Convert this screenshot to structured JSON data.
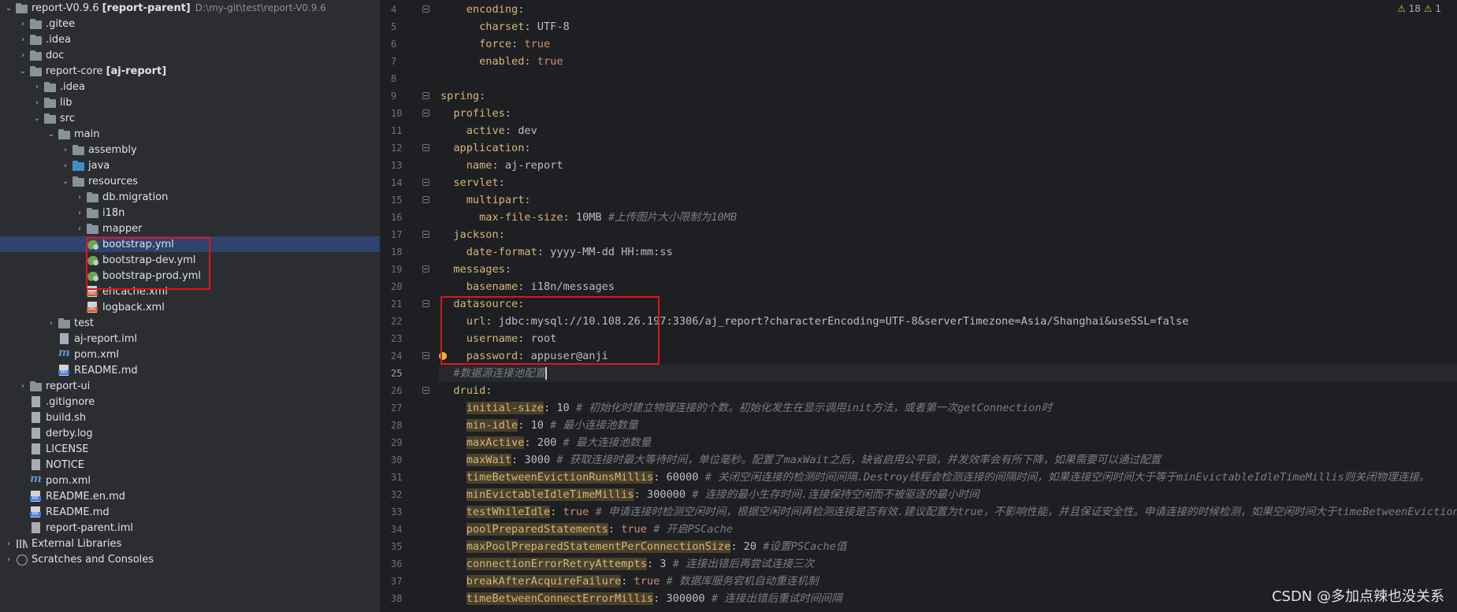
{
  "tree": [
    {
      "depth": 0,
      "arrow": "open",
      "icon": "folder",
      "label": "report-V0.9.6",
      "bold_part": "[report-parent]",
      "path": "D:\\my-git\\test\\report-V0.9.6"
    },
    {
      "depth": 1,
      "arrow": "closed",
      "icon": "folder",
      "label": ".gitee"
    },
    {
      "depth": 1,
      "arrow": "closed",
      "icon": "folder",
      "label": ".idea"
    },
    {
      "depth": 1,
      "arrow": "closed",
      "icon": "folder",
      "label": "doc"
    },
    {
      "depth": 1,
      "arrow": "open",
      "icon": "folder",
      "label": "report-core",
      "bold_part": "[aj-report]"
    },
    {
      "depth": 2,
      "arrow": "closed",
      "icon": "folder",
      "label": ".idea"
    },
    {
      "depth": 2,
      "arrow": "closed",
      "icon": "folder",
      "label": "lib"
    },
    {
      "depth": 2,
      "arrow": "open",
      "icon": "folder",
      "label": "src"
    },
    {
      "depth": 3,
      "arrow": "open",
      "icon": "folder",
      "label": "main"
    },
    {
      "depth": 4,
      "arrow": "closed",
      "icon": "folder",
      "label": "assembly"
    },
    {
      "depth": 4,
      "arrow": "closed",
      "icon": "folder-blue",
      "label": "java"
    },
    {
      "depth": 4,
      "arrow": "open",
      "icon": "folder-res",
      "label": "resources"
    },
    {
      "depth": 5,
      "arrow": "closed",
      "icon": "folder",
      "label": "db.migration"
    },
    {
      "depth": 5,
      "arrow": "closed",
      "icon": "folder",
      "label": "i18n"
    },
    {
      "depth": 5,
      "arrow": "closed",
      "icon": "folder",
      "label": "mapper"
    },
    {
      "depth": 5,
      "arrow": "none",
      "icon": "yml",
      "label": "bootstrap.yml",
      "selected": true
    },
    {
      "depth": 5,
      "arrow": "none",
      "icon": "yml",
      "label": "bootstrap-dev.yml"
    },
    {
      "depth": 5,
      "arrow": "none",
      "icon": "yml",
      "label": "bootstrap-prod.yml"
    },
    {
      "depth": 5,
      "arrow": "none",
      "icon": "xml",
      "label": "ehcache.xml"
    },
    {
      "depth": 5,
      "arrow": "none",
      "icon": "xml",
      "label": "logback.xml"
    },
    {
      "depth": 3,
      "arrow": "closed",
      "icon": "folder",
      "label": "test"
    },
    {
      "depth": 3,
      "arrow": "none",
      "icon": "iml",
      "label": "aj-report.iml"
    },
    {
      "depth": 3,
      "arrow": "none",
      "icon": "mfile",
      "label": "pom.xml"
    },
    {
      "depth": 3,
      "arrow": "none",
      "icon": "md",
      "label": "README.md"
    },
    {
      "depth": 1,
      "arrow": "closed",
      "icon": "folder",
      "label": "report-ui"
    },
    {
      "depth": 1,
      "arrow": "none",
      "icon": "file",
      "label": ".gitignore"
    },
    {
      "depth": 1,
      "arrow": "none",
      "icon": "file",
      "label": "build.sh"
    },
    {
      "depth": 1,
      "arrow": "none",
      "icon": "file",
      "label": "derby.log"
    },
    {
      "depth": 1,
      "arrow": "none",
      "icon": "file",
      "label": "LICENSE"
    },
    {
      "depth": 1,
      "arrow": "none",
      "icon": "file",
      "label": "NOTICE"
    },
    {
      "depth": 1,
      "arrow": "none",
      "icon": "mfile",
      "label": "pom.xml"
    },
    {
      "depth": 1,
      "arrow": "none",
      "icon": "md",
      "label": "README.en.md"
    },
    {
      "depth": 1,
      "arrow": "none",
      "icon": "md",
      "label": "README.md"
    },
    {
      "depth": 1,
      "arrow": "none",
      "icon": "iml",
      "label": "report-parent.iml"
    },
    {
      "depth": 0,
      "arrow": "closed",
      "icon": "lib",
      "label": "External Libraries"
    },
    {
      "depth": 0,
      "arrow": "closed",
      "icon": "scratch",
      "label": "Scratches and Consoles"
    }
  ],
  "editor": {
    "warnings": "18",
    "errors": "1",
    "current_line": 25,
    "lines": [
      {
        "n": 4,
        "parts": [
          [
            "    ",
            ""
          ],
          [
            "encoding",
            "k"
          ],
          [
            ":",
            ""
          ]
        ]
      },
      {
        "n": 5,
        "parts": [
          [
            "      ",
            ""
          ],
          [
            "charset",
            "k"
          ],
          [
            ": UTF-8",
            "v"
          ]
        ]
      },
      {
        "n": 6,
        "parts": [
          [
            "      ",
            ""
          ],
          [
            "force",
            "k"
          ],
          [
            ": ",
            ""
          ],
          [
            "true",
            "kw"
          ]
        ]
      },
      {
        "n": 7,
        "parts": [
          [
            "      ",
            ""
          ],
          [
            "enabled",
            "k"
          ],
          [
            ": ",
            ""
          ],
          [
            "true",
            "kw"
          ]
        ]
      },
      {
        "n": 8,
        "parts": []
      },
      {
        "n": 9,
        "parts": [
          [
            "spring",
            "k"
          ],
          [
            ":",
            ""
          ]
        ]
      },
      {
        "n": 10,
        "parts": [
          [
            "  ",
            ""
          ],
          [
            "profiles",
            "k"
          ],
          [
            ":",
            ""
          ]
        ]
      },
      {
        "n": 11,
        "parts": [
          [
            "    ",
            ""
          ],
          [
            "active",
            "k"
          ],
          [
            ": dev",
            "v"
          ]
        ]
      },
      {
        "n": 12,
        "parts": [
          [
            "  ",
            ""
          ],
          [
            "application",
            "k"
          ],
          [
            ":",
            ""
          ]
        ]
      },
      {
        "n": 13,
        "parts": [
          [
            "    ",
            ""
          ],
          [
            "name",
            "k"
          ],
          [
            ": aj-report",
            "v"
          ]
        ]
      },
      {
        "n": 14,
        "parts": [
          [
            "  ",
            ""
          ],
          [
            "servlet",
            "k"
          ],
          [
            ":",
            ""
          ]
        ]
      },
      {
        "n": 15,
        "parts": [
          [
            "    ",
            ""
          ],
          [
            "multipart",
            "k"
          ],
          [
            ":",
            ""
          ]
        ]
      },
      {
        "n": 16,
        "parts": [
          [
            "      ",
            ""
          ],
          [
            "max-file-size",
            "k"
          ],
          [
            ": 10MB ",
            "v"
          ],
          [
            "#上传图片大小限制为10MB",
            "c"
          ]
        ]
      },
      {
        "n": 17,
        "parts": [
          [
            "  ",
            ""
          ],
          [
            "jackson",
            "k"
          ],
          [
            ":",
            ""
          ]
        ]
      },
      {
        "n": 18,
        "parts": [
          [
            "    ",
            ""
          ],
          [
            "date-format",
            "k"
          ],
          [
            ": yyyy-MM-dd HH:mm:ss",
            "v"
          ]
        ]
      },
      {
        "n": 19,
        "parts": [
          [
            "  ",
            ""
          ],
          [
            "messages",
            "k"
          ],
          [
            ":",
            ""
          ]
        ]
      },
      {
        "n": 20,
        "parts": [
          [
            "    ",
            ""
          ],
          [
            "basename",
            "k"
          ],
          [
            ": i18n/messages",
            "v"
          ]
        ]
      },
      {
        "n": 21,
        "parts": [
          [
            "  ",
            ""
          ],
          [
            "datasource",
            "k"
          ],
          [
            ":",
            ""
          ]
        ]
      },
      {
        "n": 22,
        "parts": [
          [
            "    ",
            ""
          ],
          [
            "url",
            "k"
          ],
          [
            ": jdbc:mysql://10.108.26.197:3306/aj_report?characterEncoding=UTF-8&serverTimezone=Asia/Shanghai&useSSL=false",
            "v"
          ]
        ]
      },
      {
        "n": 23,
        "parts": [
          [
            "    ",
            ""
          ],
          [
            "username",
            "k"
          ],
          [
            ": root",
            "v"
          ]
        ]
      },
      {
        "n": 24,
        "parts": [
          [
            "    ",
            ""
          ],
          [
            "password",
            "k"
          ],
          [
            ": appuser@anji",
            "v"
          ]
        ]
      },
      {
        "n": 25,
        "parts": [
          [
            "  ",
            ""
          ],
          [
            "#数据源连接池配置",
            "c"
          ]
        ]
      },
      {
        "n": 26,
        "parts": [
          [
            "  ",
            ""
          ],
          [
            "druid",
            "k"
          ],
          [
            ":",
            ""
          ]
        ]
      },
      {
        "n": 27,
        "parts": [
          [
            "    ",
            ""
          ],
          [
            "initial-size",
            "k hl"
          ],
          [
            ": 10 ",
            "v"
          ],
          [
            "# 初始化时建立物理连接的个数。初始化发生在显示调用init方法，或者第一次getConnection时",
            "c"
          ]
        ]
      },
      {
        "n": 28,
        "parts": [
          [
            "    ",
            ""
          ],
          [
            "min-idle",
            "k hl"
          ],
          [
            ": 10 ",
            "v"
          ],
          [
            "# 最小连接池数量",
            "c"
          ]
        ]
      },
      {
        "n": 29,
        "parts": [
          [
            "    ",
            ""
          ],
          [
            "maxActive",
            "k hl"
          ],
          [
            ": 200 ",
            "v"
          ],
          [
            "# 最大连接池数量",
            "c"
          ]
        ]
      },
      {
        "n": 30,
        "parts": [
          [
            "    ",
            ""
          ],
          [
            "maxWait",
            "k hl"
          ],
          [
            ": 3000 ",
            "v"
          ],
          [
            "# 获取连接时最大等待时间，单位毫秒。配置了maxWait之后，缺省启用公平锁，并发效率会有所下降，如果需要可以通过配置",
            "c"
          ]
        ]
      },
      {
        "n": 31,
        "parts": [
          [
            "    ",
            ""
          ],
          [
            "timeBetweenEvictionRunsMillis",
            "k hl"
          ],
          [
            ": 60000 ",
            "v"
          ],
          [
            "# 关闭空闲连接的检测时间间隔.Destroy线程会检测连接的间隔时间，如果连接空闲时间大于等于minEvictableIdleTimeMillis则关闭物理连接。",
            "c"
          ]
        ]
      },
      {
        "n": 32,
        "parts": [
          [
            "    ",
            ""
          ],
          [
            "minEvictableIdleTimeMillis",
            "k hl"
          ],
          [
            ": 300000 ",
            "v"
          ],
          [
            "# 连接的最小生存时间.连接保持空闲而不被驱逐的最小时间",
            "c"
          ]
        ]
      },
      {
        "n": 33,
        "parts": [
          [
            "    ",
            ""
          ],
          [
            "testWhileIdle",
            "k hl"
          ],
          [
            ": ",
            ""
          ],
          [
            "true",
            "kw"
          ],
          [
            " ",
            ""
          ],
          [
            "# 申请连接时检测空闲时间，根据空闲时间再检测连接是否有效.建议配置为true，不影响性能，并且保证安全性。申请连接的时候检测，如果空闲时间大于timeBetweenEvictionRun",
            "c"
          ]
        ]
      },
      {
        "n": 34,
        "parts": [
          [
            "    ",
            ""
          ],
          [
            "poolPreparedStatements",
            "k hl"
          ],
          [
            ": ",
            ""
          ],
          [
            "true",
            "kw"
          ],
          [
            " ",
            ""
          ],
          [
            "# 开启PSCache",
            "c"
          ]
        ]
      },
      {
        "n": 35,
        "parts": [
          [
            "    ",
            ""
          ],
          [
            "maxPoolPreparedStatementPerConnectionSize",
            "k hl"
          ],
          [
            ": 20 ",
            "v"
          ],
          [
            "#设置PSCache值",
            "c"
          ]
        ]
      },
      {
        "n": 36,
        "parts": [
          [
            "    ",
            ""
          ],
          [
            "connectionErrorRetryAttempts",
            "k hl"
          ],
          [
            ": 3 ",
            "v"
          ],
          [
            "# 连接出错后再尝试连接三次",
            "c"
          ]
        ]
      },
      {
        "n": 37,
        "parts": [
          [
            "    ",
            ""
          ],
          [
            "breakAfterAcquireFailure",
            "k hl"
          ],
          [
            ": ",
            ""
          ],
          [
            "true",
            "kw"
          ],
          [
            " ",
            ""
          ],
          [
            "# 数据库服务宕机自动重连机制",
            "c"
          ]
        ]
      },
      {
        "n": 38,
        "parts": [
          [
            "    ",
            ""
          ],
          [
            "timeBetweenConnectErrorMillis",
            "k hl"
          ],
          [
            ": 300000 ",
            "v"
          ],
          [
            "# 连接出错后重试时间间隔",
            "c"
          ]
        ]
      }
    ]
  },
  "watermark": "CSDN @多加点辣也没关系",
  "colors": {
    "highlight_box": "#e0151b",
    "selection": "#2e436e",
    "key": "#d5b778",
    "comment": "#7a7e85",
    "keyword": "#cf8e6d"
  }
}
